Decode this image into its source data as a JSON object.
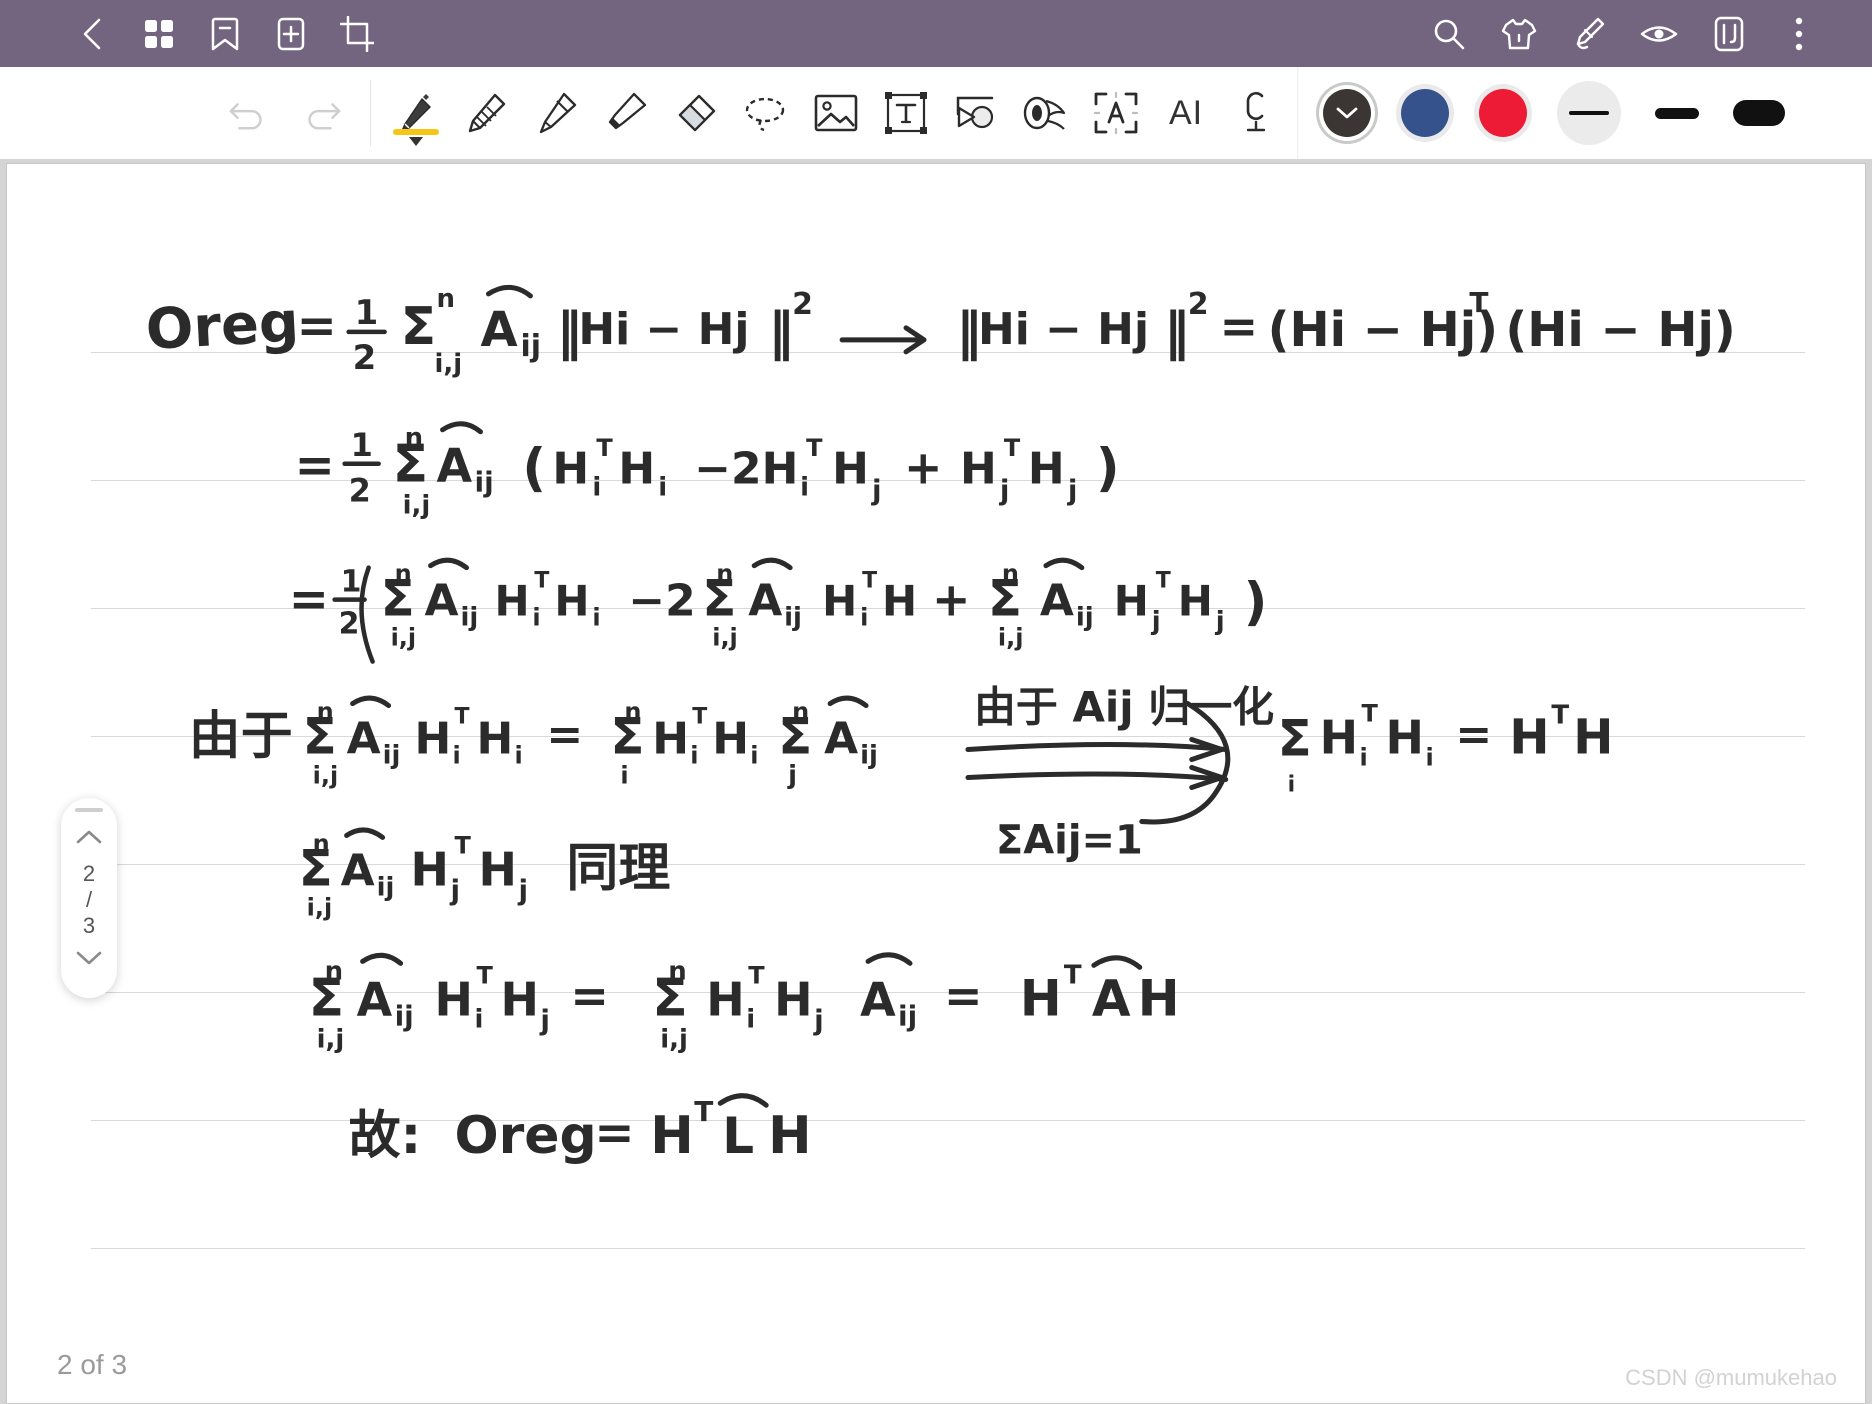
{
  "app": {
    "accent_color": "#736580",
    "canvas_bg": "#ffffff",
    "highlight_color": "#f5c518"
  },
  "topbar": {
    "left_items": [
      {
        "name": "back-icon",
        "label": "Back"
      },
      {
        "name": "grid-icon",
        "label": "Page Thumbnails"
      },
      {
        "name": "bookmark-icon",
        "label": "Bookmark"
      },
      {
        "name": "add-page-icon",
        "label": "Add Page"
      },
      {
        "name": "crop-icon",
        "label": "Crop"
      }
    ],
    "right_items": [
      {
        "name": "search-icon",
        "label": "Search"
      },
      {
        "name": "shirt-icon",
        "label": "Template"
      },
      {
        "name": "edit-pen-icon",
        "label": "Edit"
      },
      {
        "name": "eye-icon",
        "label": "Read Mode"
      },
      {
        "name": "split-view-icon",
        "label": "Split View"
      },
      {
        "name": "more-menu-icon",
        "label": "More"
      }
    ]
  },
  "toolbar": {
    "history": [
      {
        "name": "undo-button",
        "label": "Undo",
        "enabled": false
      },
      {
        "name": "redo-button",
        "label": "Redo",
        "enabled": false
      }
    ],
    "tools": [
      {
        "name": "fountain-pen-tool",
        "label": "Fountain Pen",
        "selected": true
      },
      {
        "name": "pencil-tool",
        "label": "Pencil",
        "selected": false
      },
      {
        "name": "ballpoint-pen-tool",
        "label": "Ballpoint Pen",
        "selected": false
      },
      {
        "name": "highlighter-tool",
        "label": "Highlighter",
        "selected": false
      },
      {
        "name": "eraser-tool",
        "label": "Eraser",
        "selected": false
      },
      {
        "name": "lasso-tool",
        "label": "Lasso Select",
        "selected": false
      },
      {
        "name": "image-tool",
        "label": "Insert Image",
        "selected": false
      },
      {
        "name": "text-box-tool",
        "label": "Text Box",
        "selected": false
      },
      {
        "name": "shape-tool",
        "label": "Shapes",
        "selected": false
      },
      {
        "name": "tape-tool",
        "label": "Washi Tape",
        "selected": false
      },
      {
        "name": "ocr-tool",
        "label": "Text Recognition",
        "selected": false
      },
      {
        "name": "ai-tool",
        "label": "AI",
        "selected": false
      },
      {
        "name": "microphone-tool",
        "label": "Audio Record",
        "selected": false
      }
    ],
    "ai_label": "AI",
    "colors": [
      {
        "name": "color-black-selected",
        "label": "Black",
        "hex": "#3b3633",
        "selected": true
      },
      {
        "name": "color-blue",
        "label": "Blue",
        "hex": "#36528c",
        "selected": false
      },
      {
        "name": "color-red",
        "label": "Red",
        "hex": "#ed1b35",
        "selected": false
      }
    ],
    "stroke_widths": [
      {
        "name": "stroke-width-thin",
        "label": "Thin",
        "selected": true
      },
      {
        "name": "stroke-width-medium",
        "label": "Medium",
        "selected": false
      },
      {
        "name": "stroke-width-thick",
        "label": "Thick",
        "selected": false
      }
    ]
  },
  "page_navigator": {
    "up_label": "Previous Page",
    "down_label": "Next Page",
    "current": "2",
    "separator": "/",
    "total": "3"
  },
  "footer": {
    "page_indicator": "2 of 3",
    "watermark": "CSDN @mumukehao"
  },
  "note": {
    "title": "Handwritten derivation of graph regularization term",
    "lines": [
      {
        "id": "line-1",
        "text": "Oreg = ½ Σⁿᵢⱼ Âᵢⱼ ‖Hi − Hj‖²  ⟶  ‖Hi − Hj‖² = (Hi − Hj)ᵀ (Hi − Hj)"
      },
      {
        "id": "line-2",
        "text": "= ½ Σⁿᵢⱼ Âᵢⱼ ( Hᵢᵀ Hᵢ − 2Hᵢᵀ Hⱼ + Hⱼᵀ Hⱼ )"
      },
      {
        "id": "line-3",
        "text": "= ½ ( Σⁿᵢⱼ Âᵢⱼ Hᵢᵀ Hᵢ − 2 Σⁿᵢⱼ Âᵢⱼ Hᵢᵀ H + Σⁿᵢⱼ Âᵢⱼ Hⱼᵀ Hⱼ )"
      },
      {
        "id": "line-4",
        "text": "由于 Σⁿᵢⱼ Âᵢⱼ Hᵢᵀ Hᵢ = Σⁿᵢ Hᵢᵀ Hᵢ Σⁿⱼ Âᵢⱼ"
      },
      {
        "id": "line-4-annotation-top",
        "text": "由于 Aij 归一化"
      },
      {
        "id": "line-4-annotation-bottom",
        "text": "ΣAij=1"
      },
      {
        "id": "line-4-result",
        "text": "Σᵢ Hᵢᵀ Hᵢ = HᵀH"
      },
      {
        "id": "line-5",
        "text": "Σⁿᵢⱼ Âᵢⱼ Hⱼᵀ Hⱼ 同理"
      },
      {
        "id": "line-6",
        "text": "Σⁿᵢⱼ Âᵢⱼ Hᵢᵀ Hⱼ = Σⁿᵢⱼ Hᵢᵀ Hⱼ Âᵢⱼ = Hᵀ Â H"
      },
      {
        "id": "line-7",
        "text": "故: Oreg = Hᵀ L̂ H"
      }
    ],
    "ruled_line_count": 8
  }
}
